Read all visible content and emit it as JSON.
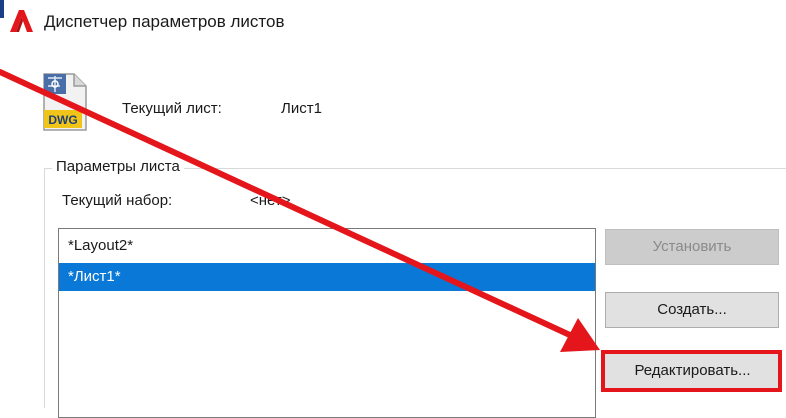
{
  "window": {
    "title": "Диспетчер параметров листов",
    "logo": "autocad-logo-red-a"
  },
  "current_sheet": {
    "icon": "dwg-file-icon",
    "icon_text": "DWG",
    "label": "Текущий лист:",
    "value": "Лист1"
  },
  "page_setups": {
    "group_title": "Параметры листа",
    "current_set_label": "Текущий набор:",
    "current_set_value": "<нет>",
    "items": [
      {
        "label": "*Layout2*",
        "selected": false
      },
      {
        "label": "*Лист1*",
        "selected": true
      }
    ]
  },
  "buttons": {
    "set_current": {
      "label": "Установить",
      "enabled": false
    },
    "new": {
      "label": "Создать..."
    },
    "modify": {
      "label": "Редактировать...",
      "highlighted": true,
      "highlight_color": "#e4161b"
    }
  },
  "annotation": {
    "type": "red-arrow",
    "color": "#e4161b",
    "points_to": "Редактировать..."
  },
  "colors": {
    "selection": "#0a78d7",
    "accent_red": "#e4161b"
  }
}
